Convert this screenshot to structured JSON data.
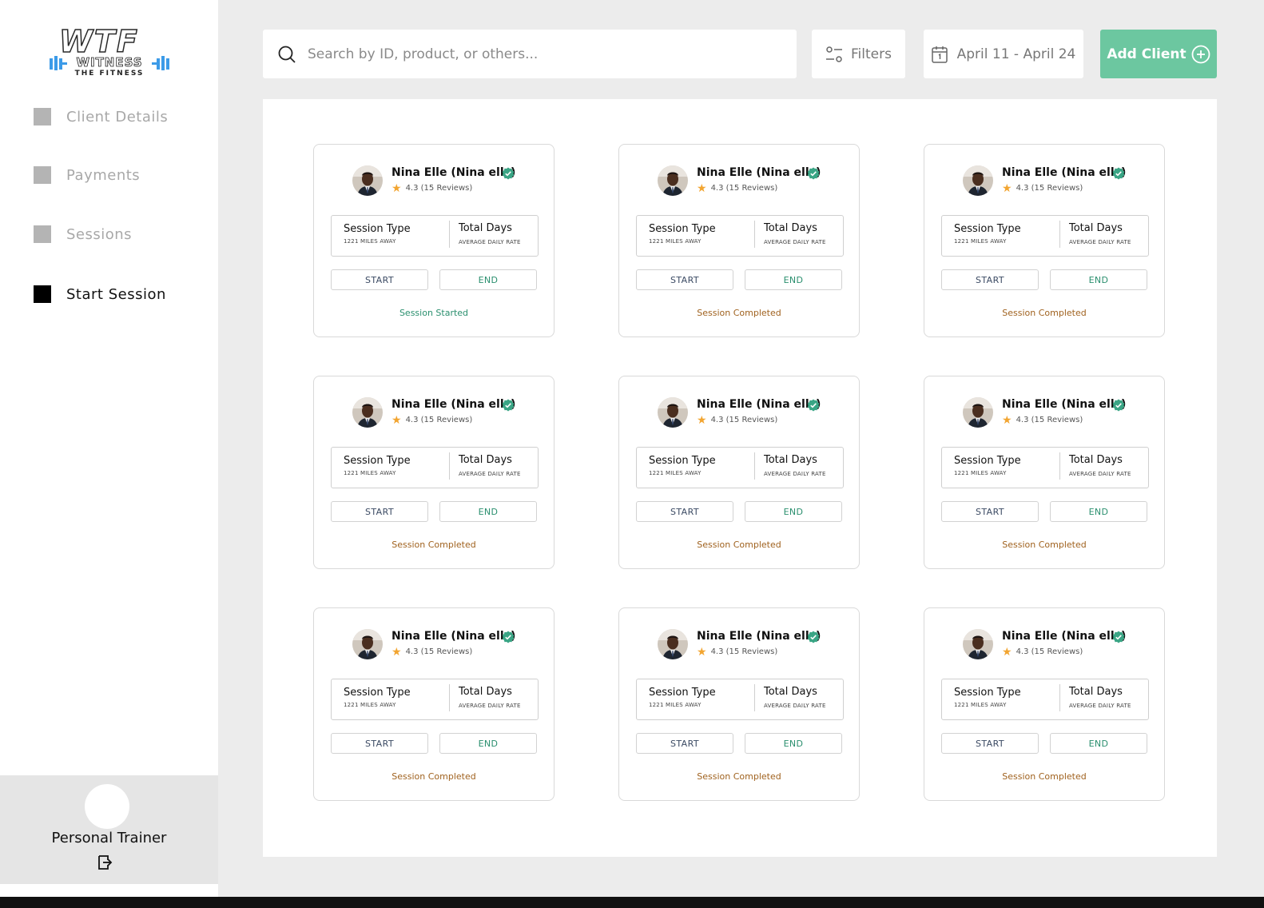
{
  "brand": {
    "logo_main": "WTF",
    "logo_sub": "WITNESS",
    "logo_tagline": "THE FITNESS"
  },
  "sidebar": {
    "items": [
      {
        "label": "Client Details",
        "active": false
      },
      {
        "label": "Payments",
        "active": false
      },
      {
        "label": "Sessions",
        "active": false
      },
      {
        "label": "Start Session",
        "active": true
      }
    ],
    "profile_role": "Personal Trainer"
  },
  "toolbar": {
    "search_placeholder": "Search by ID, product, or others...",
    "filters_label": "Filters",
    "date_range": "April 11 - April 24",
    "add_client_label": "Add Client"
  },
  "colors": {
    "accent": "#6cc7a0",
    "status_started": "#2a8f6e",
    "status_completed": "#a0621f",
    "star": "#f2a531"
  },
  "cards": [
    {
      "name": "Nina Elle (Nina ells)",
      "rating": "4.3 (15 Reviews)",
      "col1_title": "Session Type",
      "col1_sub": "1221 MILES AWAY",
      "col2_title": "Total Days",
      "col2_sub": "AVERAGE DAILY RATE",
      "start_label": "START",
      "end_label": "END",
      "status": "Session Started"
    },
    {
      "name": "Nina Elle (Nina ells)",
      "rating": "4.3 (15 Reviews)",
      "col1_title": "Session Type",
      "col1_sub": "1221 MILES AWAY",
      "col2_title": "Total Days",
      "col2_sub": "AVERAGE DAILY RATE",
      "start_label": "START",
      "end_label": "END",
      "status": "Session Completed"
    },
    {
      "name": "Nina Elle (Nina ells)",
      "rating": "4.3 (15 Reviews)",
      "col1_title": "Session Type",
      "col1_sub": "1221 MILES AWAY",
      "col2_title": "Total Days",
      "col2_sub": "AVERAGE DAILY RATE",
      "start_label": "START",
      "end_label": "END",
      "status": "Session Completed"
    },
    {
      "name": "Nina Elle (Nina ells)",
      "rating": "4.3 (15 Reviews)",
      "col1_title": "Session Type",
      "col1_sub": "1221 MILES AWAY",
      "col2_title": "Total Days",
      "col2_sub": "AVERAGE DAILY RATE",
      "start_label": "START",
      "end_label": "END",
      "status": "Session Completed"
    },
    {
      "name": "Nina Elle (Nina ells)",
      "rating": "4.3 (15 Reviews)",
      "col1_title": "Session Type",
      "col1_sub": "1221 MILES AWAY",
      "col2_title": "Total Days",
      "col2_sub": "AVERAGE DAILY RATE",
      "start_label": "START",
      "end_label": "END",
      "status": "Session Completed"
    },
    {
      "name": "Nina Elle (Nina ells)",
      "rating": "4.3 (15 Reviews)",
      "col1_title": "Session Type",
      "col1_sub": "1221 MILES AWAY",
      "col2_title": "Total Days",
      "col2_sub": "AVERAGE DAILY RATE",
      "start_label": "START",
      "end_label": "END",
      "status": "Session Completed"
    },
    {
      "name": "Nina Elle (Nina ells)",
      "rating": "4.3 (15 Reviews)",
      "col1_title": "Session Type",
      "col1_sub": "1221 MILES AWAY",
      "col2_title": "Total Days",
      "col2_sub": "AVERAGE DAILY RATE",
      "start_label": "START",
      "end_label": "END",
      "status": "Session Completed"
    },
    {
      "name": "Nina Elle (Nina ells)",
      "rating": "4.3 (15 Reviews)",
      "col1_title": "Session Type",
      "col1_sub": "1221 MILES AWAY",
      "col2_title": "Total Days",
      "col2_sub": "AVERAGE DAILY RATE",
      "start_label": "START",
      "end_label": "END",
      "status": "Session Completed"
    },
    {
      "name": "Nina Elle (Nina ells)",
      "rating": "4.3 (15 Reviews)",
      "col1_title": "Session Type",
      "col1_sub": "1221 MILES AWAY",
      "col2_title": "Total Days",
      "col2_sub": "AVERAGE DAILY RATE",
      "start_label": "START",
      "end_label": "END",
      "status": "Session Completed"
    }
  ]
}
